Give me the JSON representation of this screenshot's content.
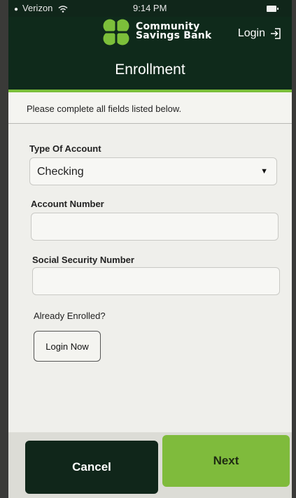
{
  "status_bar": {
    "carrier": "Verizon",
    "time": "9:14 PM"
  },
  "header": {
    "brand_line1": "Community",
    "brand_line2": "Savings Bank",
    "login_label": "Login",
    "page_title": "Enrollment"
  },
  "instructions": "Please complete all fields listed below.",
  "form": {
    "account_type": {
      "label": "Type Of Account",
      "value": "Checking"
    },
    "account_number": {
      "label": "Account Number",
      "value": ""
    },
    "ssn": {
      "label": "Social Security Number",
      "value": ""
    },
    "already_enrolled": "Already Enrolled?",
    "login_now": "Login Now"
  },
  "footer": {
    "cancel_label": "Cancel",
    "next_label": "Next"
  },
  "colors": {
    "dark_green": "#10261a",
    "accent_green": "#7fbb3a"
  },
  "icons": [
    "wifi-icon",
    "battery-icon",
    "clover-logo-icon",
    "login-icon",
    "dropdown-caret-icon"
  ]
}
